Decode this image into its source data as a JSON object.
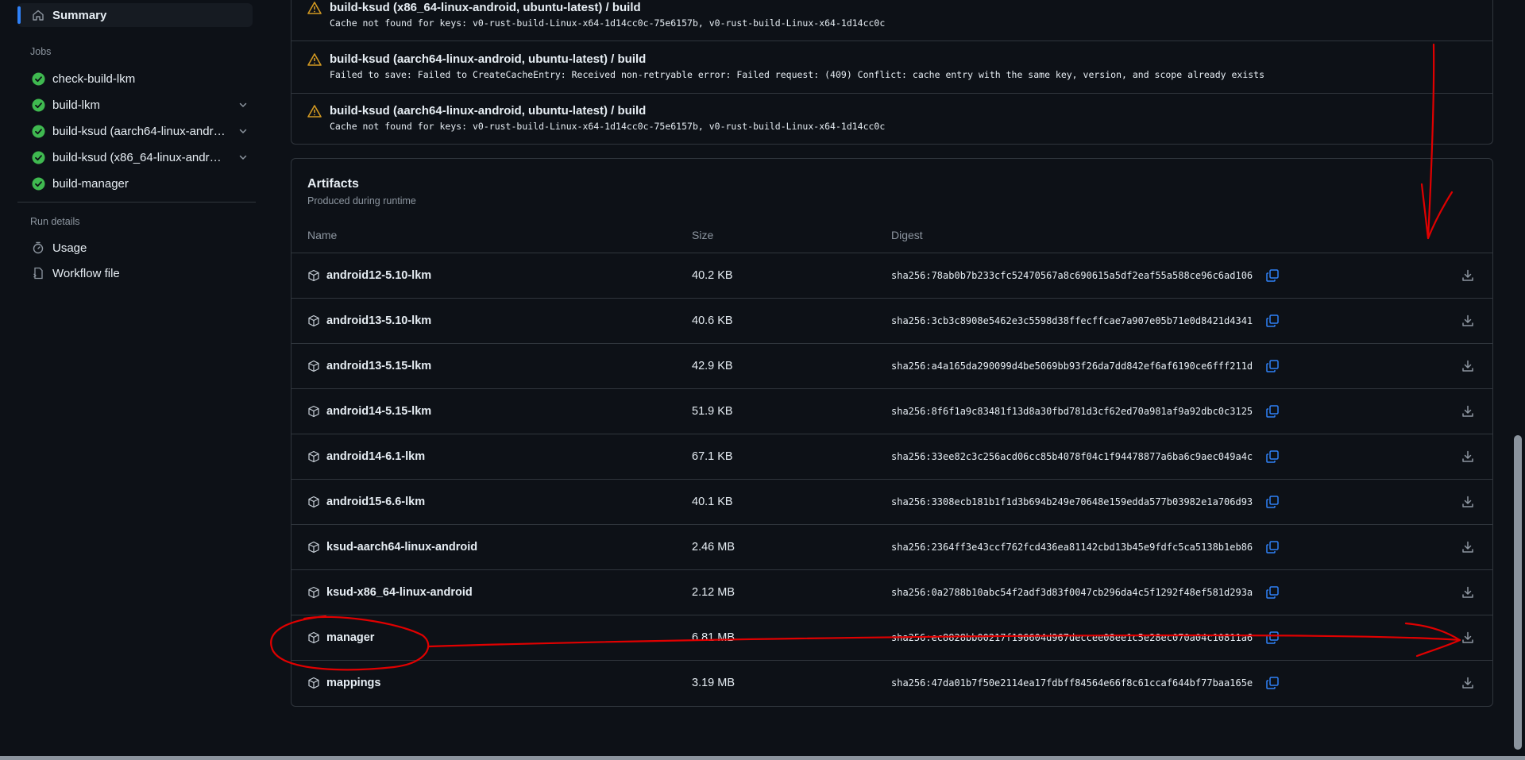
{
  "sidebar": {
    "summary_label": "Summary",
    "jobs_title": "Jobs",
    "jobs": [
      {
        "label": "check-build-lkm",
        "expandable": false
      },
      {
        "label": "build-lkm",
        "expandable": true
      },
      {
        "label": "build-ksud (aarch64-linux-android, ubuntu-latest)",
        "expandable": true
      },
      {
        "label": "build-ksud (x86_64-linux-android, ubuntu-latest)",
        "expandable": true
      },
      {
        "label": "build-manager",
        "expandable": false
      }
    ],
    "run_details_title": "Run details",
    "details": [
      {
        "label": "Usage",
        "icon": "stopwatch-icon"
      },
      {
        "label": "Workflow file",
        "icon": "file-icon"
      }
    ]
  },
  "annotations": [
    {
      "title": "build-ksud (x86_64-linux-android, ubuntu-latest) / build",
      "message": "Cache not found for keys: v0-rust-build-Linux-x64-1d14cc0c-75e6157b, v0-rust-build-Linux-x64-1d14cc0c"
    },
    {
      "title": "build-ksud (aarch64-linux-android, ubuntu-latest) / build",
      "message": "Failed to save: Failed to CreateCacheEntry: Received non-retryable error: Failed request: (409) Conflict: cache entry with the same key, version, and scope already exists"
    },
    {
      "title": "build-ksud (aarch64-linux-android, ubuntu-latest) / build",
      "message": "Cache not found for keys: v0-rust-build-Linux-x64-1d14cc0c-75e6157b, v0-rust-build-Linux-x64-1d14cc0c"
    }
  ],
  "artifacts": {
    "title": "Artifacts",
    "subtitle": "Produced during runtime",
    "columns": {
      "name": "Name",
      "size": "Size",
      "digest": "Digest"
    },
    "rows": [
      {
        "name": "android12-5.10-lkm",
        "size": "40.2 KB",
        "digest": "sha256:78ab0b7b233cfc52470567a8c690615a5df2eaf55a588ce96c6ad106"
      },
      {
        "name": "android13-5.10-lkm",
        "size": "40.6 KB",
        "digest": "sha256:3cb3c8908e5462e3c5598d38ffecffcae7a907e05b71e0d8421d4341"
      },
      {
        "name": "android13-5.15-lkm",
        "size": "42.9 KB",
        "digest": "sha256:a4a165da290099d4be5069bb93f26da7dd842ef6af6190ce6fff211d"
      },
      {
        "name": "android14-5.15-lkm",
        "size": "51.9 KB",
        "digest": "sha256:8f6f1a9c83481f13d8a30fbd781d3cf62ed70a981af9a92dbc0c3125"
      },
      {
        "name": "android14-6.1-lkm",
        "size": "67.1 KB",
        "digest": "sha256:33ee82c3c256acd06cc85b4078f04c1f94478877a6ba6c9aec049a4c"
      },
      {
        "name": "android15-6.6-lkm",
        "size": "40.1 KB",
        "digest": "sha256:3308ecb181b1f1d3b694b249e70648e159edda577b03982e1a706d93"
      },
      {
        "name": "ksud-aarch64-linux-android",
        "size": "2.46 MB",
        "digest": "sha256:2364ff3e43ccf762fcd436ea81142cbd13b45e9fdfc5ca5138b1eb86"
      },
      {
        "name": "ksud-x86_64-linux-android",
        "size": "2.12 MB",
        "digest": "sha256:0a2788b10abc54f2adf3d83f0047cb296da4c5f1292f48ef581d293a"
      },
      {
        "name": "manager",
        "size": "6.81 MB",
        "digest": "sha256:ec8828bb00217f196604d967deccee08ee1c5e28ec070a04c10811a6"
      },
      {
        "name": "mappings",
        "size": "3.19 MB",
        "digest": "sha256:47da01b7f50e2114ea17fdbff84564e66f8c61ccaf644bf77baa165e"
      }
    ]
  },
  "colors": {
    "background": "#0d1117",
    "border": "#30363d",
    "success": "#3fb950",
    "warning": "#d29922",
    "link": "#2f81f7",
    "annotation_red": "#e00000"
  }
}
